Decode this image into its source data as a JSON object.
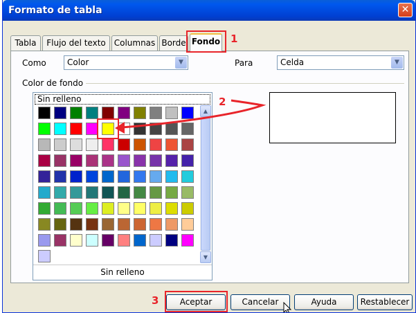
{
  "window": {
    "title": "Formato de tabla",
    "close_glyph": "✕"
  },
  "tabs": [
    {
      "label": "Tabla",
      "active": false
    },
    {
      "label": "Flujo del texto",
      "active": false
    },
    {
      "label": "Columnas",
      "active": false
    },
    {
      "label": "Borde",
      "active": false
    },
    {
      "label": "Fondo",
      "active": true
    }
  ],
  "form": {
    "como_label": "Como",
    "como_value": "Color",
    "para_label": "Para",
    "para_value": "Celda",
    "group_label": "Color de fondo"
  },
  "palette": {
    "selected_label": "Sin relleno",
    "footer_label": "Sin relleno",
    "selected_color": "#ffff00",
    "rows": [
      [
        "#000000",
        "#000080",
        "#008000",
        "#008080",
        "#800000",
        "#800080",
        "#808000",
        "#808080",
        "#c0c0c0",
        "#0000ff"
      ],
      [
        "#00ff00",
        "#00ffff",
        "#ff0000",
        "#ff00ff",
        "#ffff00",
        "#ffffff",
        "#333333",
        "#444444",
        "#555555",
        "#666666"
      ],
      [
        "#b8b8b8",
        "#cccccc",
        "#dddddd",
        "#eeeeee",
        "#ff3366",
        "#cc0000",
        "#cc5500",
        "#ee4444",
        "#ee5533",
        "#aa4444"
      ],
      [
        "#aa0044",
        "#993366",
        "#990066",
        "#aa3377",
        "#aa3388",
        "#9955cc",
        "#8833aa",
        "#7733aa",
        "#5522aa",
        "#4422aa"
      ],
      [
        "#332299",
        "#2233aa",
        "#0022cc",
        "#0044dd",
        "#0066cc",
        "#2266dd",
        "#3377ee",
        "#66aaee",
        "#22bbee",
        "#22ccdd"
      ],
      [
        "#22aacc",
        "#33aaaa",
        "#339999",
        "#227777",
        "#115555",
        "#226644",
        "#448844",
        "#669944",
        "#77aa44",
        "#99bb66"
      ],
      [
        "#33aa33",
        "#44bb55",
        "#55cc55",
        "#66ee44",
        "#ddee22",
        "#ffff88",
        "#ffff66",
        "#eeee44",
        "#dddd00",
        "#cccc00"
      ],
      [
        "#888822",
        "#666611",
        "#553311",
        "#773311",
        "#996633",
        "#bb6633",
        "#cc6633",
        "#ee7744",
        "#ee9966",
        "#ffcc99"
      ],
      [
        "#9999ee",
        "#993366",
        "#ffffcc",
        "#ccffff",
        "#660066",
        "#ff8080",
        "#0066cc",
        "#ccccff",
        "#000080",
        "#ff00ff"
      ],
      [
        "#ccccff"
      ]
    ]
  },
  "buttons": {
    "ok": "Aceptar",
    "cancel": "Cancelar",
    "help": "Ayuda",
    "reset": "Restablecer"
  },
  "annotations": {
    "n1": "1",
    "n2": "2",
    "n3": "3",
    "color": "#e8242a"
  },
  "icons": {
    "close": "close-icon",
    "dropdown": "chevron-down-icon",
    "scroll_up": "scroll-up-icon",
    "scroll_down": "scroll-down-icon",
    "cursor": "mouse-pointer-icon"
  }
}
